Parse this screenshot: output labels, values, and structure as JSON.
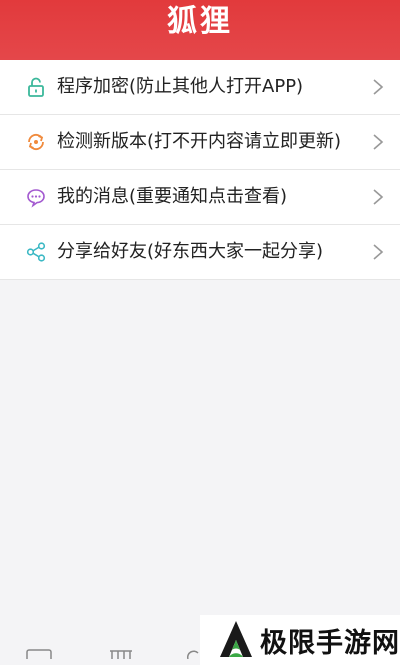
{
  "header": {
    "title": "狐狸",
    "color": "#e4474a"
  },
  "menu": {
    "items": [
      {
        "label": "程序加密(防止其他人打开APP)",
        "icon": "lock-icon",
        "color": "#3bb89b"
      },
      {
        "label": "检测新版本(打不开内容请立即更新)",
        "icon": "refresh-icon",
        "color": "#f08a3c"
      },
      {
        "label": "我的消息(重要通知点击查看)",
        "icon": "message-icon",
        "color": "#a35ad0"
      },
      {
        "label": "分享给好友(好东西大家一起分享)",
        "icon": "share-icon",
        "color": "#3bb8c4"
      }
    ]
  },
  "watermark": {
    "text": "极限手游网",
    "icon": "brand-logo"
  }
}
